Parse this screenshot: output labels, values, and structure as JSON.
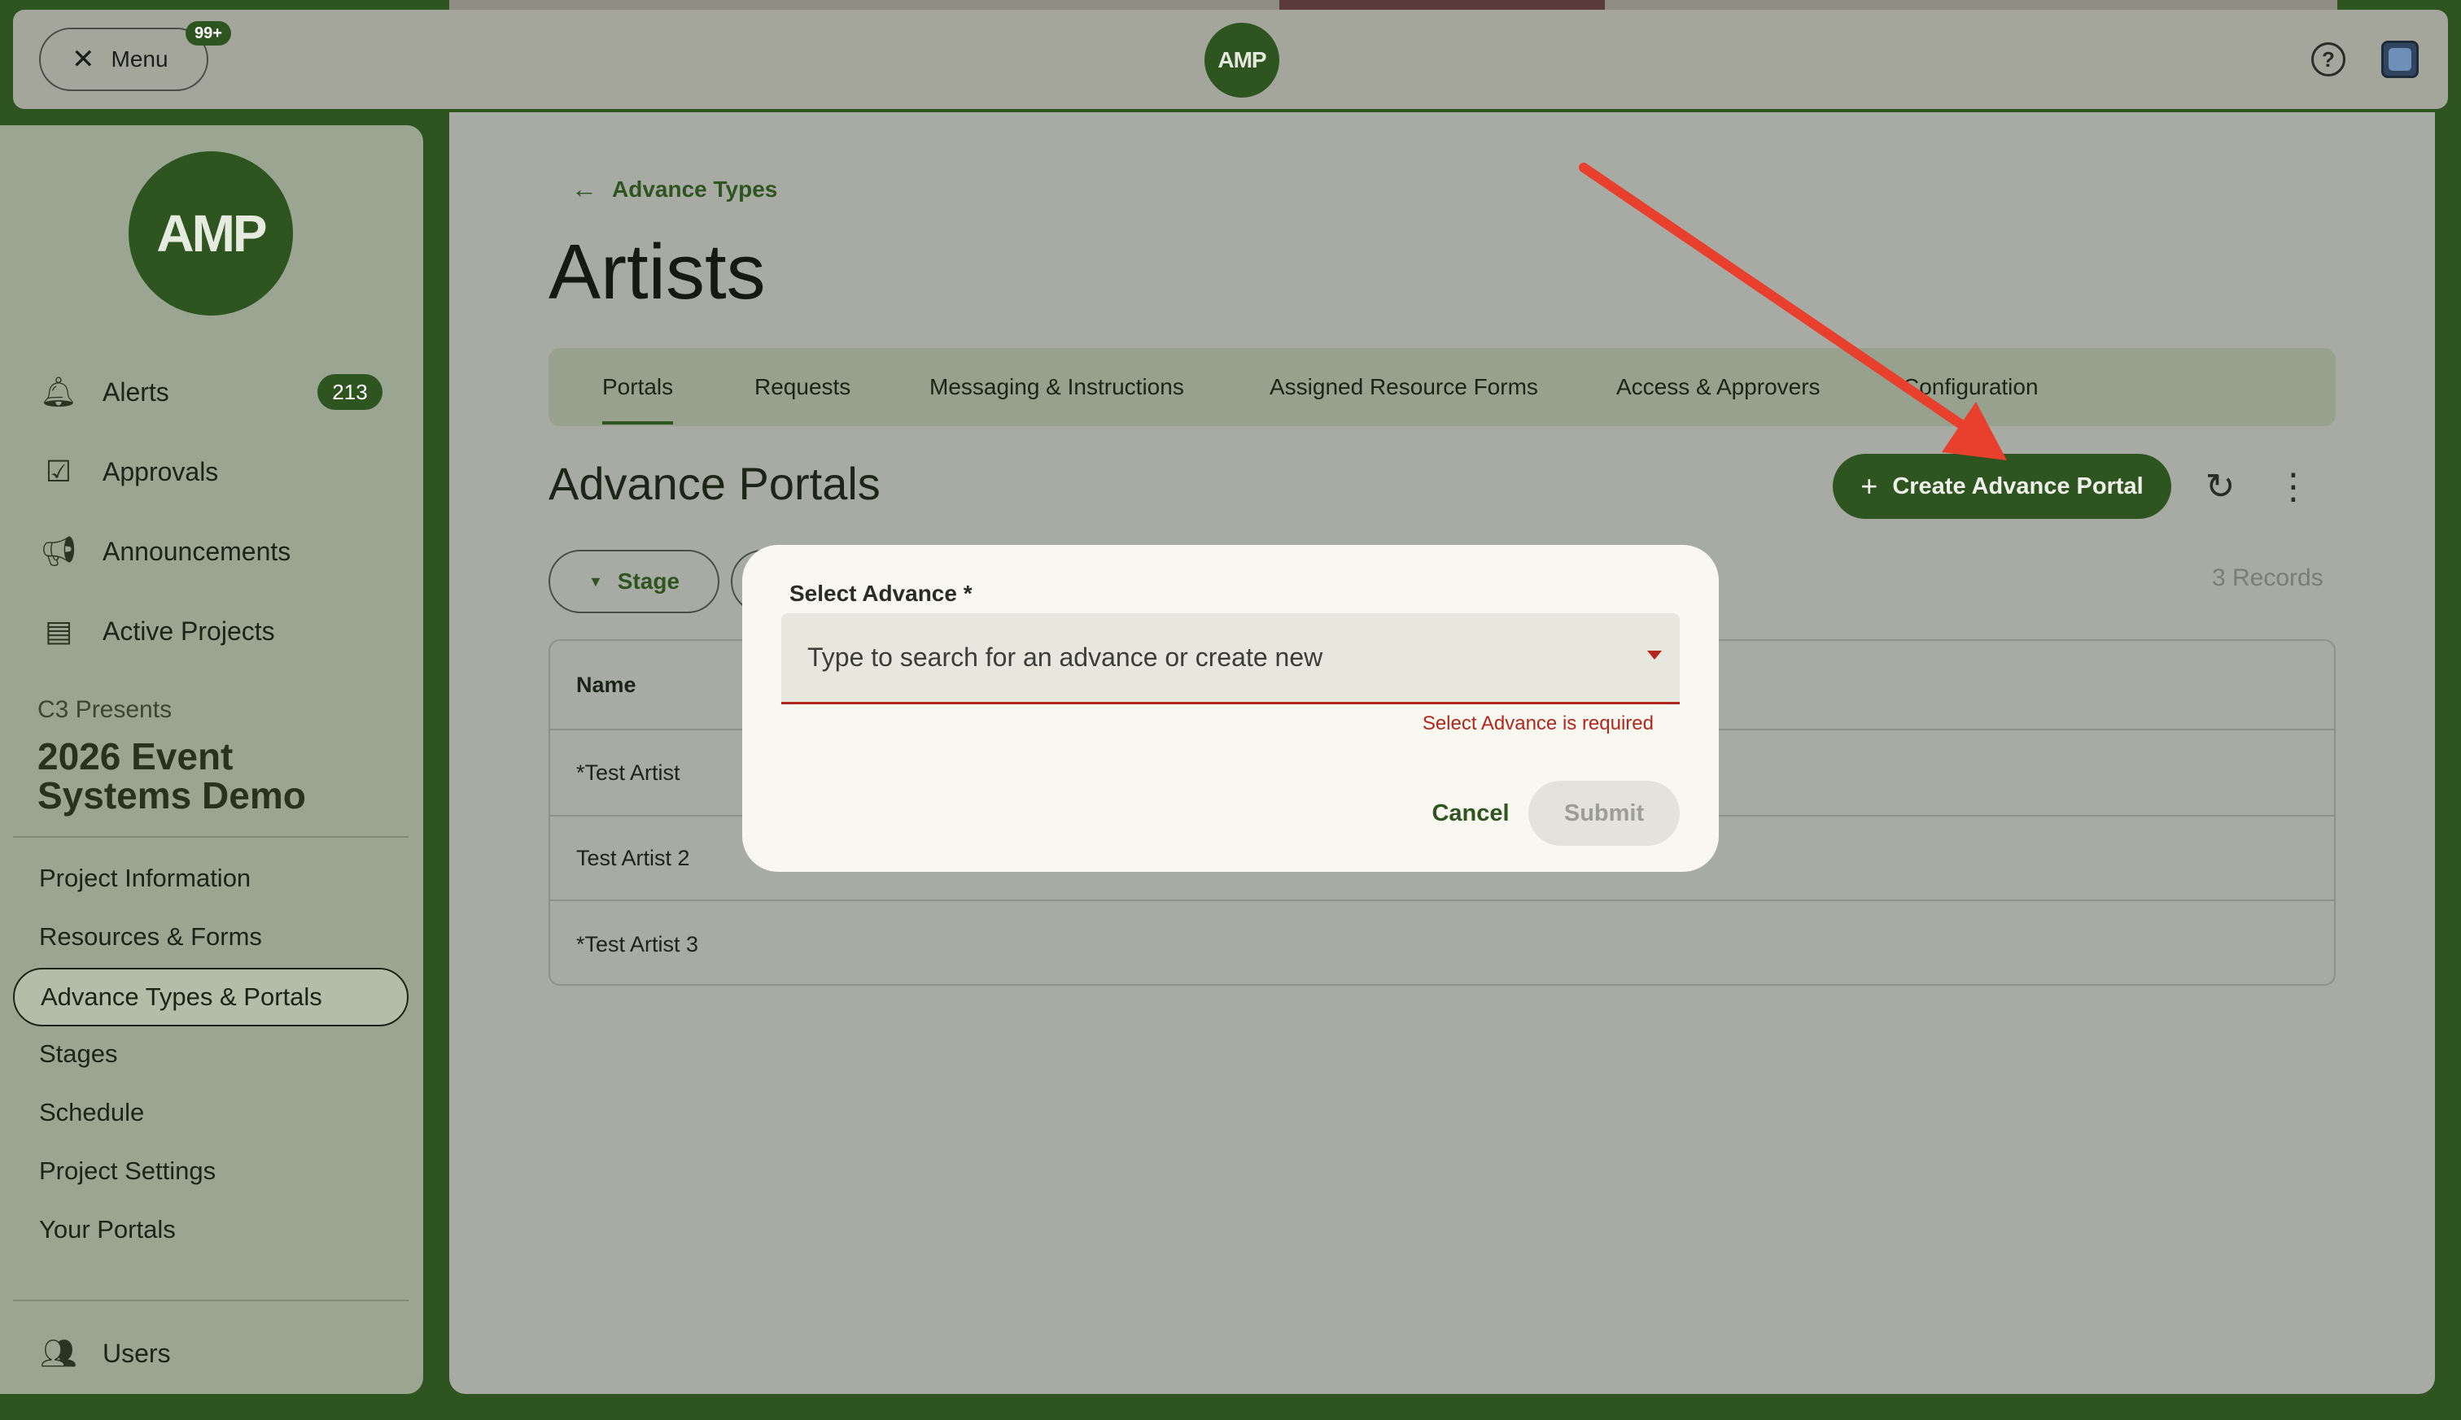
{
  "topbar": {
    "menu_label": "Menu",
    "menu_badge": "99+",
    "logo_text": "AMP"
  },
  "sidebar": {
    "logo_text": "AMP",
    "nav": [
      {
        "label": "Alerts",
        "icon": "bell-icon"
      },
      {
        "label": "Approvals",
        "icon": "calendar-check-icon"
      },
      {
        "label": "Announcements",
        "icon": "megaphone-icon"
      },
      {
        "label": "Active Projects",
        "icon": "projects-icon"
      }
    ],
    "alerts_count": "213",
    "org": "C3 Presents",
    "project": "2026 Event Systems Demo",
    "sub_items": [
      "Project Information",
      "Resources & Forms",
      "Advance Types & Portals",
      "Stages",
      "Schedule",
      "Project Settings",
      "Your Portals"
    ],
    "users_label": "Users"
  },
  "main": {
    "back_label": "Advance Types",
    "title": "Artists",
    "tabs": [
      "Portals",
      "Requests",
      "Messaging & Instructions",
      "Assigned Resource Forms",
      "Access & Approvers",
      "Configuration"
    ],
    "section_title": "Advance Portals",
    "create_label": "Create Advance Portal",
    "filter_stage": "Stage",
    "records": "3 Records",
    "table": {
      "header": "Name",
      "rows": [
        "*Test Artist",
        "Test Artist 2",
        "*Test Artist 3"
      ]
    }
  },
  "dialog": {
    "label": "Select Advance *",
    "placeholder": "Type to search for an advance or create new",
    "error": "Select Advance is required",
    "cancel": "Cancel",
    "submit": "Submit"
  },
  "colors": {
    "brand": "#2e5420",
    "error": "#b3261e",
    "annotation": "#e8402c"
  }
}
